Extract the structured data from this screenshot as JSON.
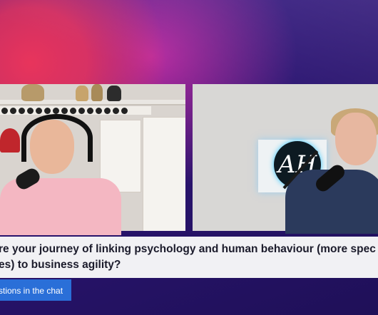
{
  "caption": {
    "line1": "re your journey of linking psychology and human behaviour (more spec",
    "line2": "es) to business agility?"
  },
  "chat_button": {
    "label": "stions in the chat"
  },
  "right_video": {
    "logo_text": "AH"
  },
  "colors": {
    "background_pink": "#e8345c",
    "background_purple": "#2a1470",
    "button_blue": "#2a6fd8",
    "caption_bg": "#f1f1f4"
  }
}
